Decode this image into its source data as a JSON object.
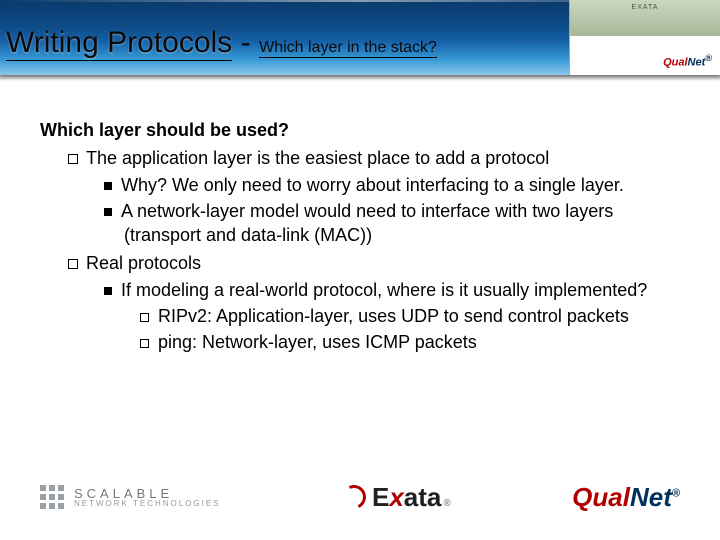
{
  "corner": {
    "topLabel": "EXATA"
  },
  "title": {
    "main": "Writing Protocols",
    "sep": "-",
    "sub": "Which layer in the stack?"
  },
  "body": {
    "heading": "Which layer should be used?",
    "b1": "The application layer is the easiest place to add a protocol",
    "b1a": "Why?  We only need to worry about interfacing to a single layer.",
    "b1b": "A network-layer model would need to interface with two layers (transport and data-link (MAC))",
    "b2": "Real protocols",
    "b2a": "If modeling a real-world protocol, where is it usually implemented?",
    "b2a1": "RIPv2:  Application-layer, uses UDP to send control packets",
    "b2a2": "ping:  Network-layer, uses ICMP packets"
  },
  "footer": {
    "snt1": "SCALABLE",
    "snt2": "NETWORK TECHNOLOGIES",
    "exata_e": "E",
    "exata_x": "x",
    "exata_rest": "ata",
    "tm": "®",
    "qual": "Qual",
    "net": "Net",
    "reg": "®"
  }
}
